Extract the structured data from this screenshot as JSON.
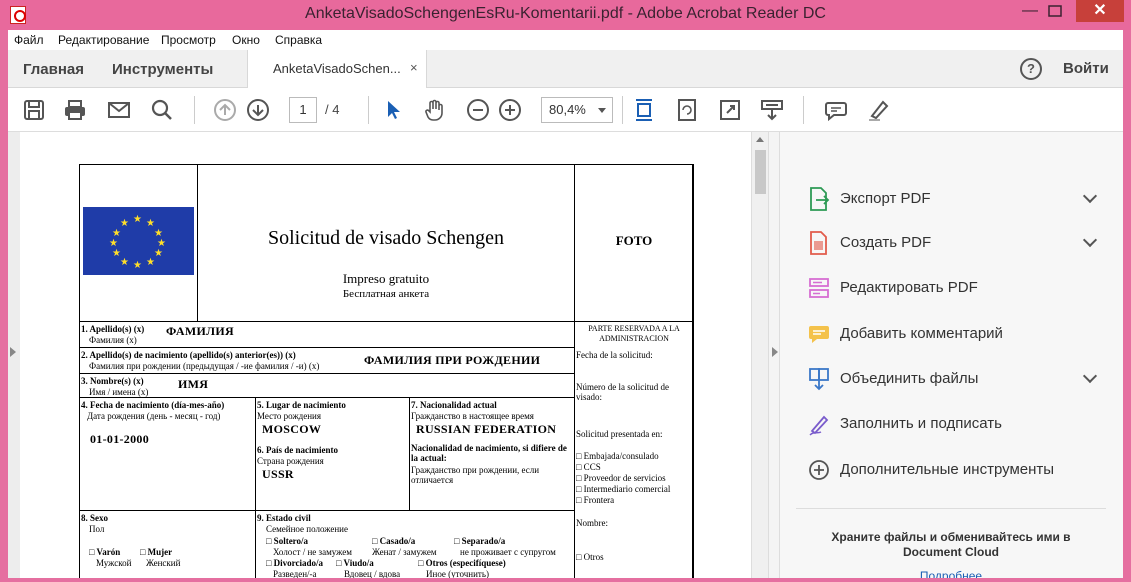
{
  "window": {
    "title": "AnketaVisadoSchengenEsRu-Komentarii.pdf - Adobe Acrobat Reader DC",
    "min": "—",
    "max": "",
    "close": "✕"
  },
  "menu": [
    "Файл",
    "Редактирование",
    "Просмотр",
    "Окно",
    "Справка"
  ],
  "tabs": {
    "home": "Главная",
    "tools": "Инструменты",
    "doc": "AnketaVisadoSchen...",
    "doc_close": "×",
    "help": "?",
    "signin": "Войти"
  },
  "toolbar": {
    "page_current": "1",
    "page_total": "/ 4",
    "zoom": "80,4%",
    "icons": [
      "save-icon",
      "print-icon",
      "email-icon",
      "search-icon",
      "page-up-icon",
      "page-down-icon",
      "select-cursor-icon",
      "hand-icon",
      "zoom-out-icon",
      "zoom-in-icon",
      "fit-page-icon",
      "rotate-icon",
      "fullscreen-icon",
      "read-mode-icon",
      "comment-icon",
      "highlight-icon"
    ]
  },
  "rightpane": {
    "items": [
      {
        "label": "Экспорт PDF",
        "icon": "export-pdf-icon",
        "color": "#2e9a55",
        "expand": true
      },
      {
        "label": "Создать PDF",
        "icon": "create-pdf-icon",
        "color": "#e25c4c",
        "expand": true
      },
      {
        "label": "Редактировать PDF",
        "icon": "edit-pdf-icon",
        "color": "#d66fd2",
        "expand": false
      },
      {
        "label": "Добавить комментарий",
        "icon": "comment-icon",
        "color": "#f3b82d",
        "expand": false
      },
      {
        "label": "Объединить файлы",
        "icon": "combine-files-icon",
        "color": "#3b78c8",
        "expand": true
      },
      {
        "label": "Заполнить и подписать",
        "icon": "fill-sign-icon",
        "color": "#7a5ccc",
        "expand": false
      },
      {
        "label": "Дополнительные инструменты",
        "icon": "more-tools-icon",
        "color": "#555555",
        "expand": false
      }
    ],
    "cloud_line1": "Храните файлы и обменивайтесь ими в",
    "cloud_line2": "Document Cloud",
    "more": "Подробнее"
  },
  "form": {
    "title": "Solicitud de visado Schengen",
    "subtitle_es": "Impreso gratuito",
    "subtitle_ru": "Бесплатная анкета",
    "photo": "FOTO",
    "admin_header": "PARTE RESERVADA A LA ADMINISTRACION",
    "f1_label": "1. Apellido(s) (x)",
    "f1_sub": "Фамилия (х)",
    "f1_value": "ФАМИЛИЯ",
    "f2_label": "2. Apellido(s) de nacimiento (apellido(s) anterior(es)) (x)",
    "f2_sub": "Фамилия при рождении (предыдущая / -ие фамилия / -и) (х)",
    "f2_value": "ФАМИЛИЯ ПРИ РОЖДЕНИИ",
    "f3_label": "3. Nombre(s) (x)",
    "f3_sub": "Имя / имена (х)",
    "f3_value": "ИМЯ",
    "f4_label": "4. Fecha de nacimiento (día-mes-año)",
    "f4_sub": "Дата рождения (день - месяц - год)",
    "f4_value": "01-01-2000",
    "f5_label": "5. Lugar de nacimiento",
    "f5_sub": "Место рождения",
    "f5_value": "MOSCOW",
    "f6_label": "6. País de nacimiento",
    "f6_sub": "Страна рождения",
    "f6_value": "USSR",
    "f7_label": "7. Nacionalidad actual",
    "f7_sub": "Гражданство в настоящее время",
    "f7_value": "RUSSIAN FEDERATION",
    "f7b_label": "Nacionalidad de nacimiento, si difiere de la actual:",
    "f7b_sub": "Гражданство при рождении, если отличается",
    "f8_label": "8. Sexo",
    "f8_sub": "Пол",
    "f8_male": "□ Varón",
    "f8_female": "□ Mujer",
    "f8_male_ru": "Мужской",
    "f8_female_ru": "Женский",
    "f9_label": "9. Estado civil",
    "f9_sub": "Семейное положение",
    "f9_single": "□ Soltero/a",
    "f9_married": "□ Casado/a",
    "f9_separated": "□ Separado/a",
    "f9_single_ru": "Холост / не замужем",
    "f9_married_ru": "Женат / замужем",
    "f9_separated_ru": "не проживает с супругом",
    "f9_divorced": "□ Divorciado/a",
    "f9_widowed": "□ Viudo/a",
    "f9_other": "□ Otros (especifíquese)",
    "f9_divorced_ru": "Разведен/-а",
    "f9_widowed_ru": "Вдовец / вдова",
    "f9_other_ru": "Иное (уточнить)",
    "admin_date": "Fecha de la solicitud:",
    "admin_number": "Número de la solicitud de visado:",
    "admin_presented": "Solicitud presentada en:",
    "admin_opt1": "□ Embajada/consulado",
    "admin_opt2": "□ CCS",
    "admin_opt3": "□ Proveedor de servicios",
    "admin_opt4": "□ Intermediario comercial",
    "admin_opt5": "□ Frontera",
    "admin_name": "Nombre:",
    "admin_other": "□ Otros"
  }
}
